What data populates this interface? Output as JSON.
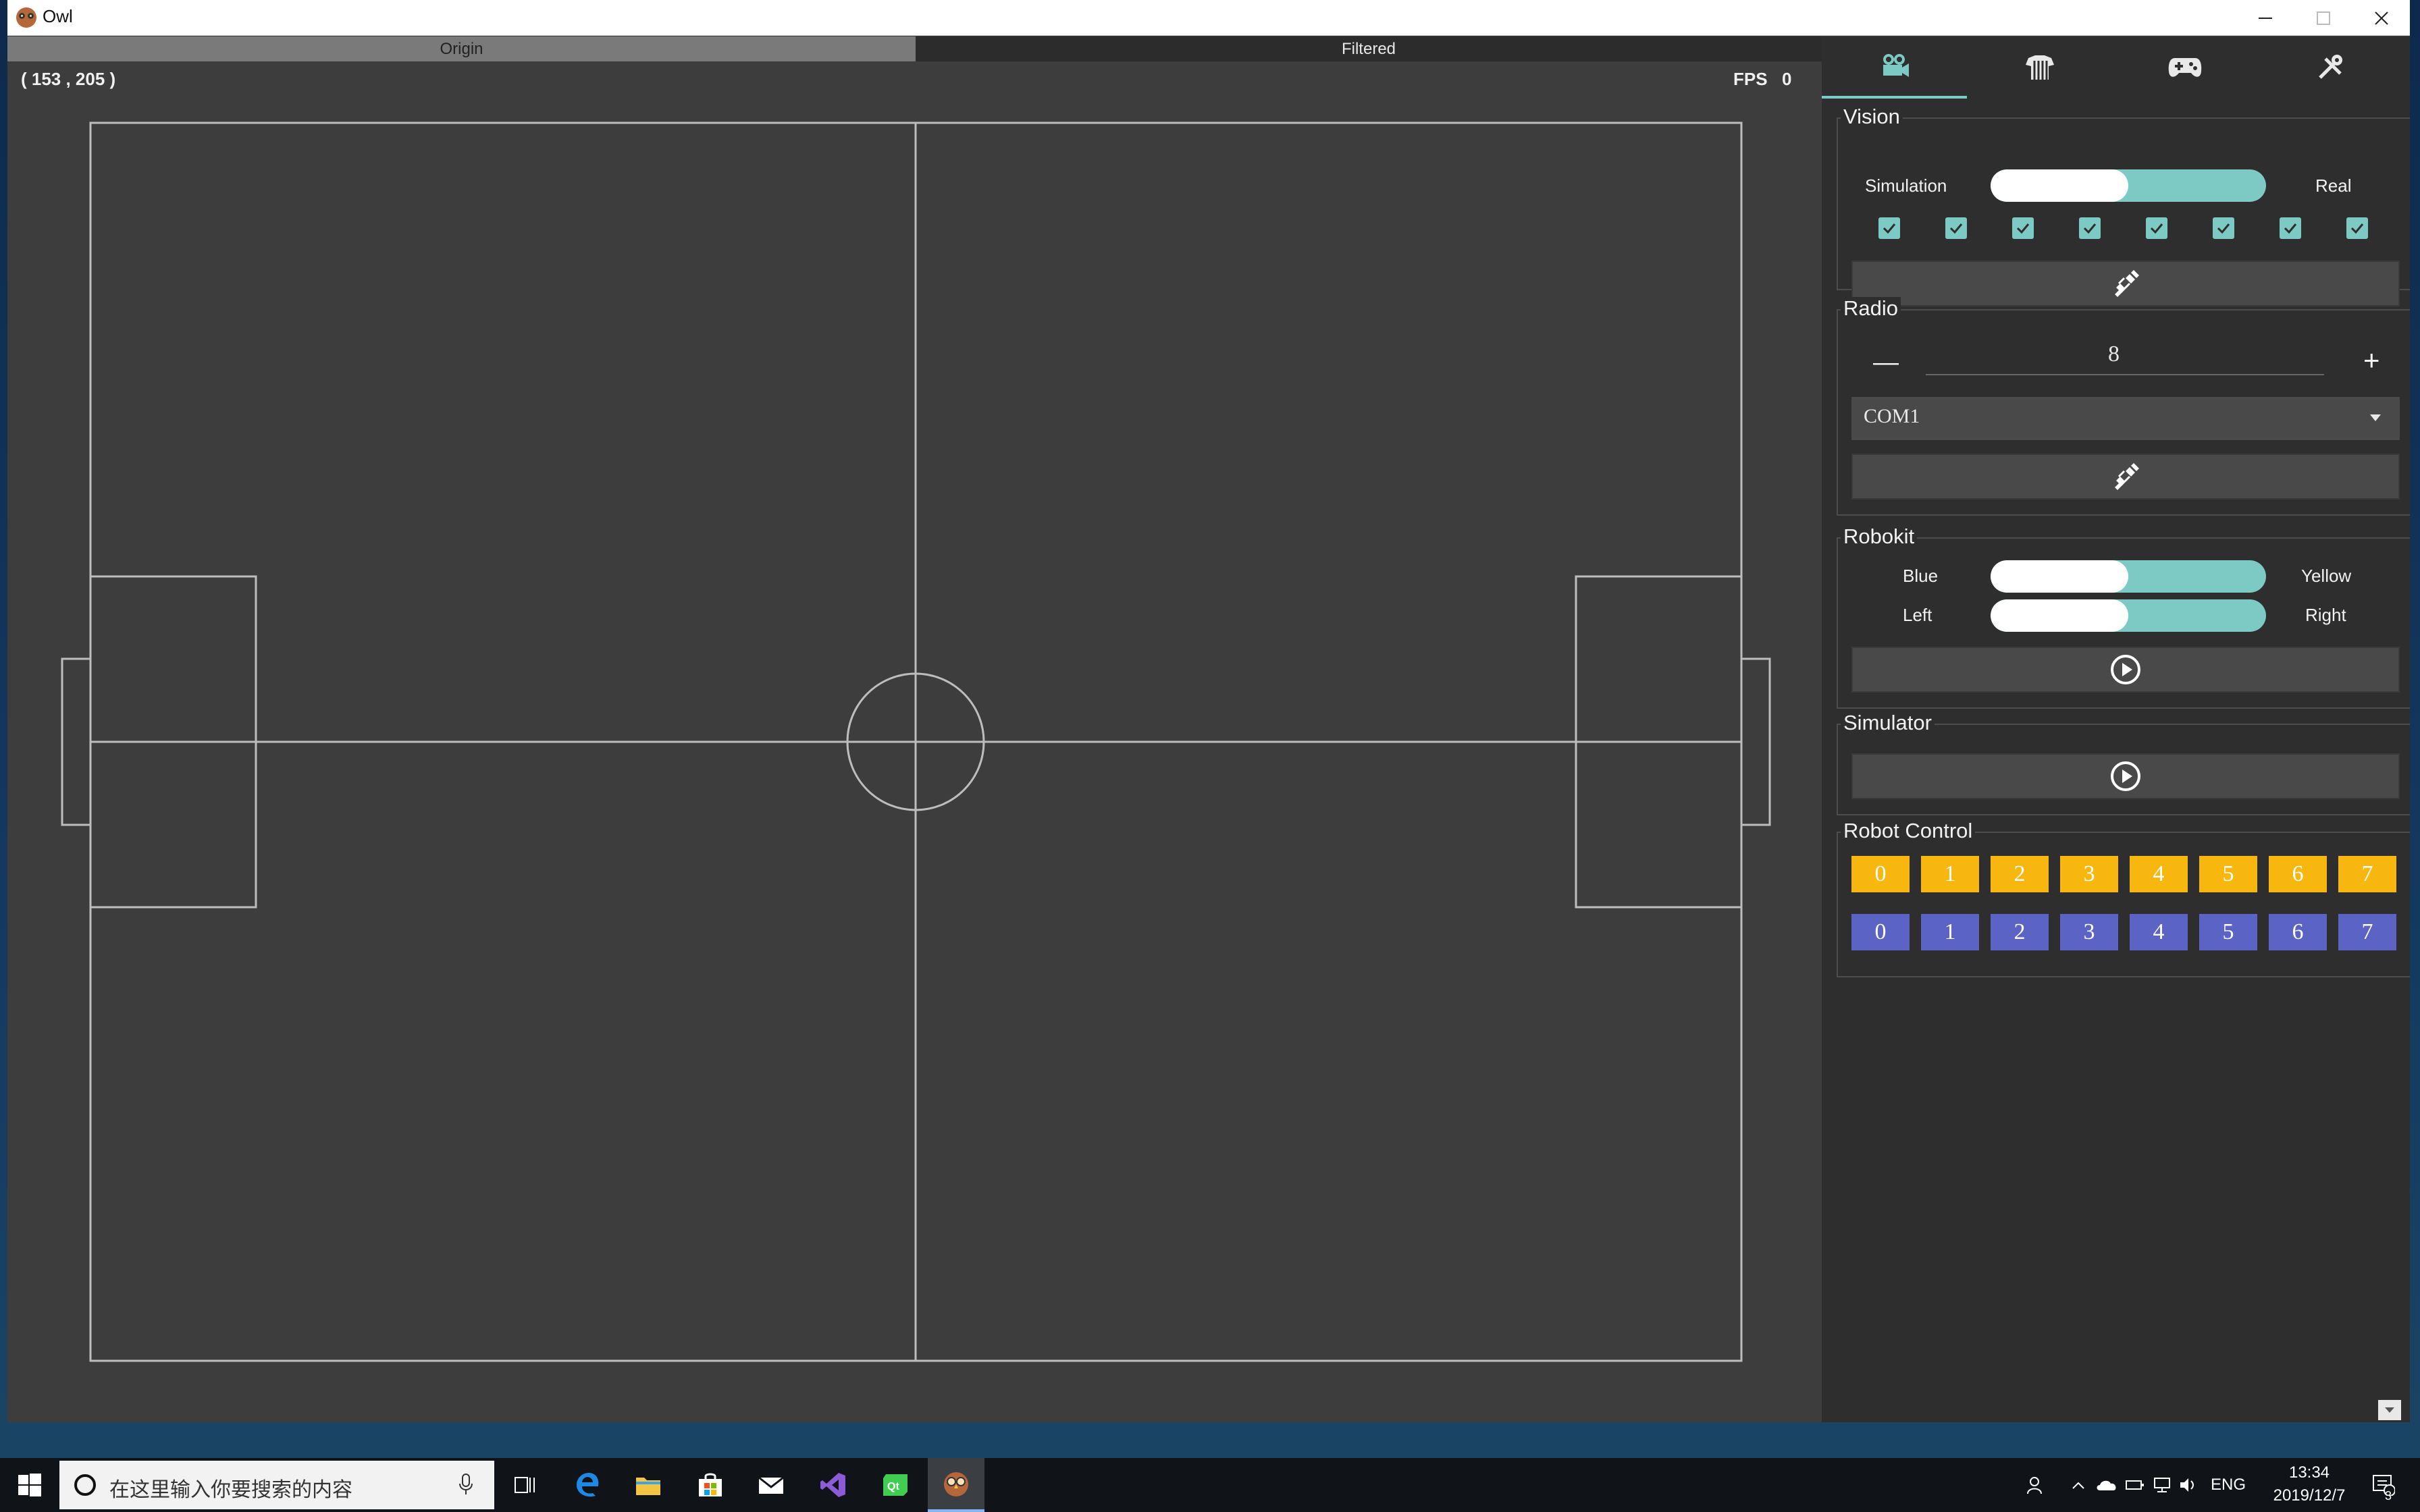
{
  "window": {
    "title": "Owl",
    "controls": [
      "minimize",
      "maximize",
      "close"
    ]
  },
  "view_tabs": [
    {
      "label": "Origin",
      "selected": true
    },
    {
      "label": "Filtered",
      "selected": false
    }
  ],
  "field": {
    "coordinates": "( 153 , 205 )",
    "fps_label": "FPS",
    "fps_value": "0",
    "line_color": "#bdbdbd",
    "background_color": "#3d3d3d"
  },
  "panel": {
    "tabs": [
      {
        "icon": "camera-icon",
        "active": true
      },
      {
        "icon": "jersey-icon",
        "active": false
      },
      {
        "icon": "gamepad-icon",
        "active": false
      },
      {
        "icon": "tools-icon",
        "active": false
      }
    ],
    "accent_color": "#7ccac3",
    "vision": {
      "title": "Vision",
      "toggle_left": "Simulation",
      "toggle_right": "Real",
      "checkboxes": [
        true,
        true,
        true,
        true,
        true,
        true,
        true,
        true
      ],
      "connect_icon": "plug-icon"
    },
    "radio": {
      "title": "Radio",
      "minus": "—",
      "plus": "+",
      "frequency": "8",
      "port": "COM1",
      "connect_icon": "plug-icon"
    },
    "robokit": {
      "title": "Robokit",
      "team_left": "Blue",
      "team_right": "Yellow",
      "side_left": "Left",
      "side_right": "Right",
      "start_icon": "play-icon"
    },
    "simulator": {
      "title": "Simulator",
      "start_icon": "play-icon"
    },
    "robot_control": {
      "title": "Robot Control",
      "yellow_color": "#f7b70f",
      "blue_color": "#5b63c5",
      "yellow": [
        "0",
        "1",
        "2",
        "3",
        "4",
        "5",
        "6",
        "7"
      ],
      "blue": [
        "0",
        "1",
        "2",
        "3",
        "4",
        "5",
        "6",
        "7"
      ]
    }
  },
  "taskbar": {
    "search_placeholder": "在这里输入你要搜索的内容",
    "apps": [
      "task-view-icon",
      "edge-icon",
      "file-explorer-icon",
      "store-icon",
      "mail-icon",
      "visual-studio-icon",
      "qt-creator-icon",
      "owl-app-icon"
    ],
    "tray": {
      "language": "ENG",
      "time": "13:34",
      "date": "2019/12/7",
      "notifications": "3"
    }
  }
}
